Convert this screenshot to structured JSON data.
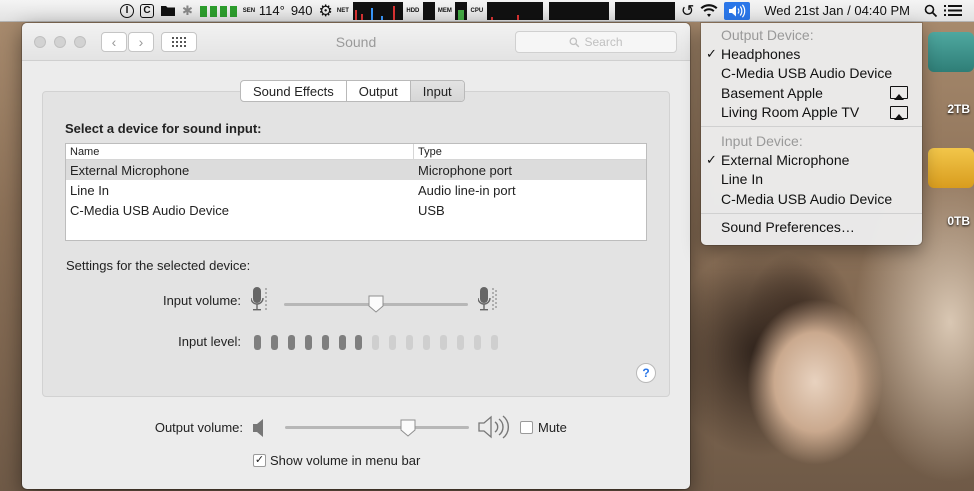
{
  "menubar": {
    "icons": [
      "onepassword-icon",
      "cmdc-icon",
      "folder-icon",
      "bluetooth-icon",
      "battery-icon",
      "temperature-icon",
      "gear-icon",
      "network-icon",
      "activity-graph-icon",
      "hdd-icon",
      "memory-icon",
      "cpu-icon",
      "time-machine-icon",
      "wifi-icon",
      "volume-icon",
      "search-icon",
      "list-icon"
    ],
    "temperature": "114°",
    "fan_speed": "940",
    "net_label": "NET",
    "hdd_label": "HDD",
    "mem_label": "MEM",
    "cpu_label": "CPU",
    "sensor_label": "SEN",
    "datetime": "Wed 21st Jan / 04:40 PM"
  },
  "window": {
    "title": "Sound",
    "search_placeholder": "Search",
    "tabs": [
      {
        "label": "Sound Effects",
        "active": false
      },
      {
        "label": "Output",
        "active": false
      },
      {
        "label": "Input",
        "active": true
      }
    ],
    "heading": "Select a device for sound input:",
    "table": {
      "columns": [
        "Name",
        "Type"
      ],
      "rows": [
        {
          "name": "External Microphone",
          "type": "Microphone port",
          "selected": true
        },
        {
          "name": "Line In",
          "type": "Audio line-in port",
          "selected": false
        },
        {
          "name": "C-Media USB Audio Device",
          "type": "USB",
          "selected": false
        }
      ]
    },
    "settings_label": "Settings for the selected device:",
    "input_volume_label": "Input volume:",
    "input_volume": 0.5,
    "input_level_label": "Input level:",
    "input_level_segments": 15,
    "input_level_active": 7,
    "help_label": "?",
    "output_volume_label": "Output volume:",
    "output_volume": 0.67,
    "mute_label": "Mute",
    "mute_checked": false,
    "show_volume_label": "Show volume in menu bar",
    "show_volume_checked": true
  },
  "menu": {
    "output_header": "Output Device:",
    "output_items": [
      {
        "label": "Headphones",
        "checked": true,
        "airplay": false
      },
      {
        "label": "C-Media USB Audio Device",
        "checked": false,
        "airplay": false
      },
      {
        "label": "Basement Apple",
        "checked": false,
        "airplay": true
      },
      {
        "label": "Living Room Apple TV",
        "checked": false,
        "airplay": true
      }
    ],
    "input_header": "Input Device:",
    "input_items": [
      {
        "label": "External Microphone",
        "checked": true
      },
      {
        "label": "Line In",
        "checked": false
      },
      {
        "label": "C-Media USB Audio Device",
        "checked": false
      }
    ],
    "preferences_label": "Sound Preferences…"
  },
  "desktop": {
    "disks": [
      {
        "label": "2TB"
      },
      {
        "label": "0TB"
      }
    ]
  },
  "colors": {
    "accent": "#2a76e8",
    "level_active": "#7f7f7f",
    "level_inactive": "#cfcfcf"
  }
}
